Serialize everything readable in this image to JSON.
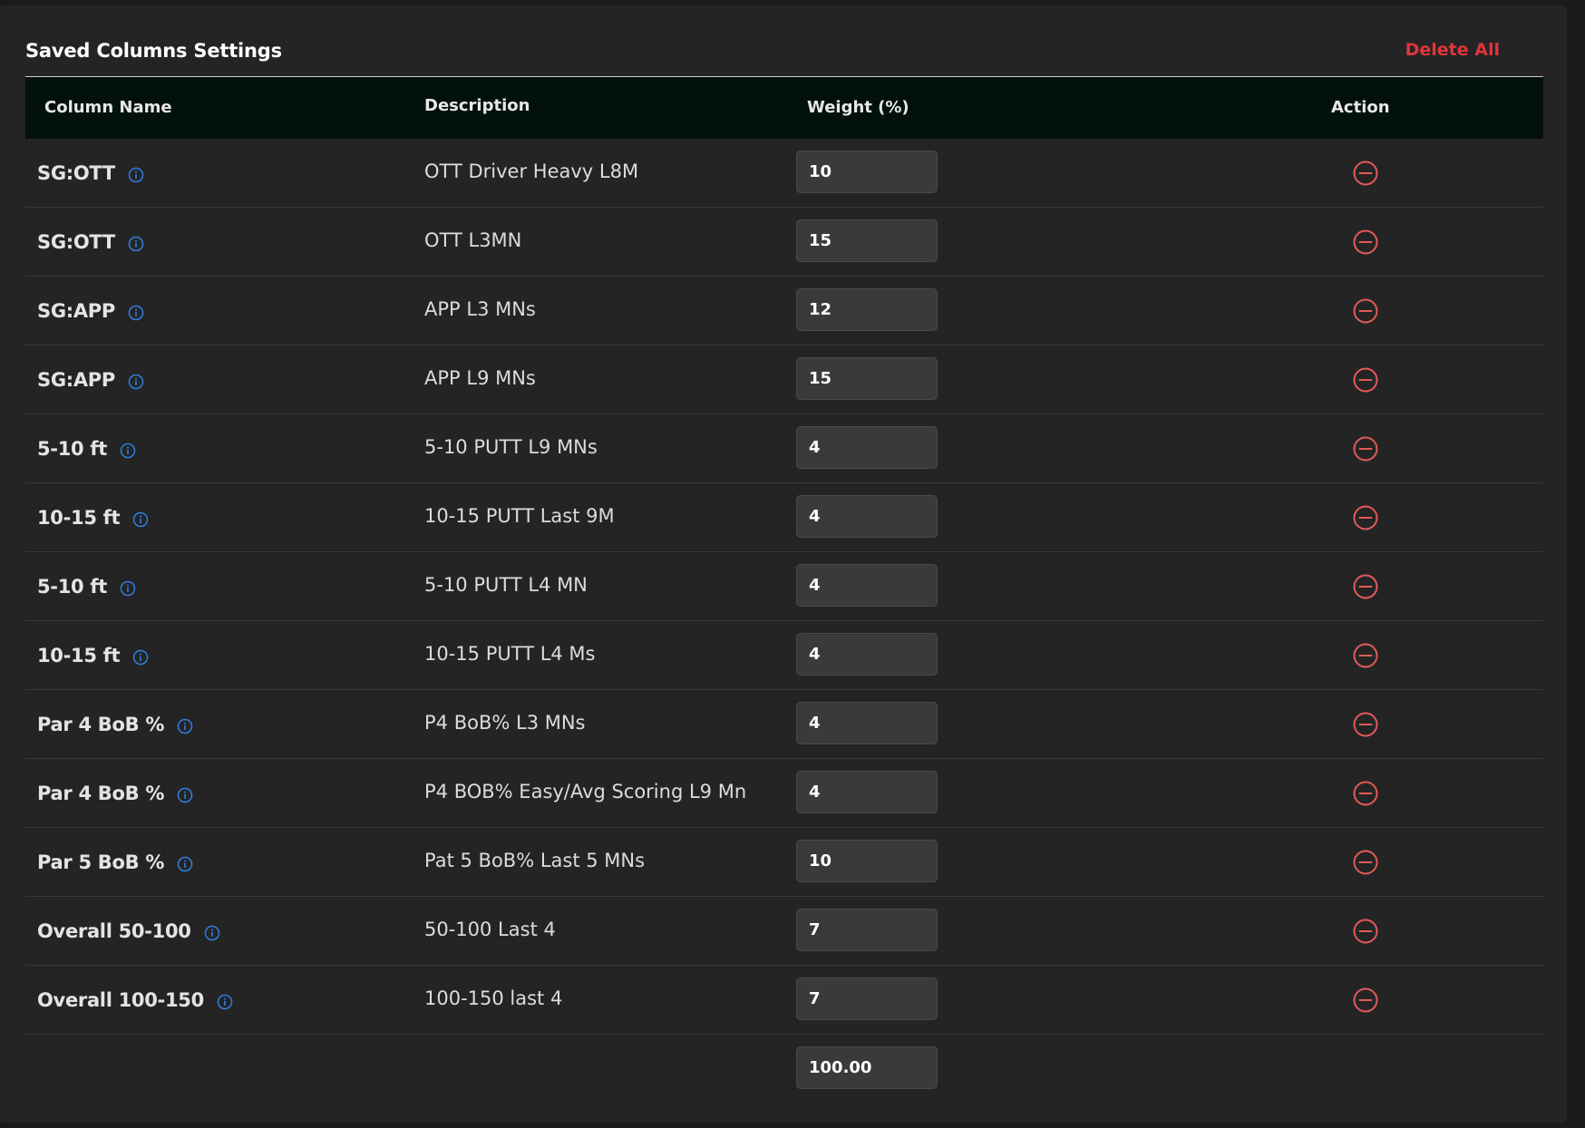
{
  "panel": {
    "title": "Saved Columns Settings",
    "delete_all_label": "Delete All"
  },
  "table": {
    "headers": {
      "column_name": "Column Name",
      "description": "Description",
      "weight": "Weight (%)",
      "action": "Action"
    },
    "rows": [
      {
        "name": "SG:OTT",
        "description": "OTT Driver Heavy L8M",
        "weight": "10"
      },
      {
        "name": "SG:OTT",
        "description": "OTT L3MN",
        "weight": "15"
      },
      {
        "name": "SG:APP",
        "description": "APP L3 MNs",
        "weight": "12"
      },
      {
        "name": "SG:APP",
        "description": "APP L9 MNs",
        "weight": "15"
      },
      {
        "name": "5-10 ft",
        "description": "5-10 PUTT L9 MNs",
        "weight": "4"
      },
      {
        "name": "10-15 ft",
        "description": "10-15 PUTT Last 9M",
        "weight": "4"
      },
      {
        "name": "5-10 ft",
        "description": "5-10 PUTT L4 MN",
        "weight": "4"
      },
      {
        "name": "10-15 ft",
        "description": "10-15 PUTT L4 Ms",
        "weight": "4"
      },
      {
        "name": "Par 4 BoB %",
        "description": "P4 BoB% L3 MNs",
        "weight": "4"
      },
      {
        "name": "Par 4 BoB %",
        "description": "P4 BOB% Easy/Avg Scoring L9 Mn",
        "weight": "4"
      },
      {
        "name": "Par 5 BoB %",
        "description": "Pat 5 BoB% Last 5 MNs",
        "weight": "10"
      },
      {
        "name": "Overall 50-100",
        "description": "50-100 Last 4",
        "weight": "7"
      },
      {
        "name": "Overall 100-150",
        "description": "100-150 last 4",
        "weight": "7"
      }
    ],
    "total_weight": "100.00"
  },
  "icons": {
    "info": "info-circle-icon",
    "remove": "minus-circle-icon"
  },
  "colors": {
    "panel_bg": "#242424",
    "header_bg": "#03110d",
    "accent_red": "#e0353a",
    "remove_icon": "#e25a5a",
    "info_icon": "#2f7fe0"
  }
}
